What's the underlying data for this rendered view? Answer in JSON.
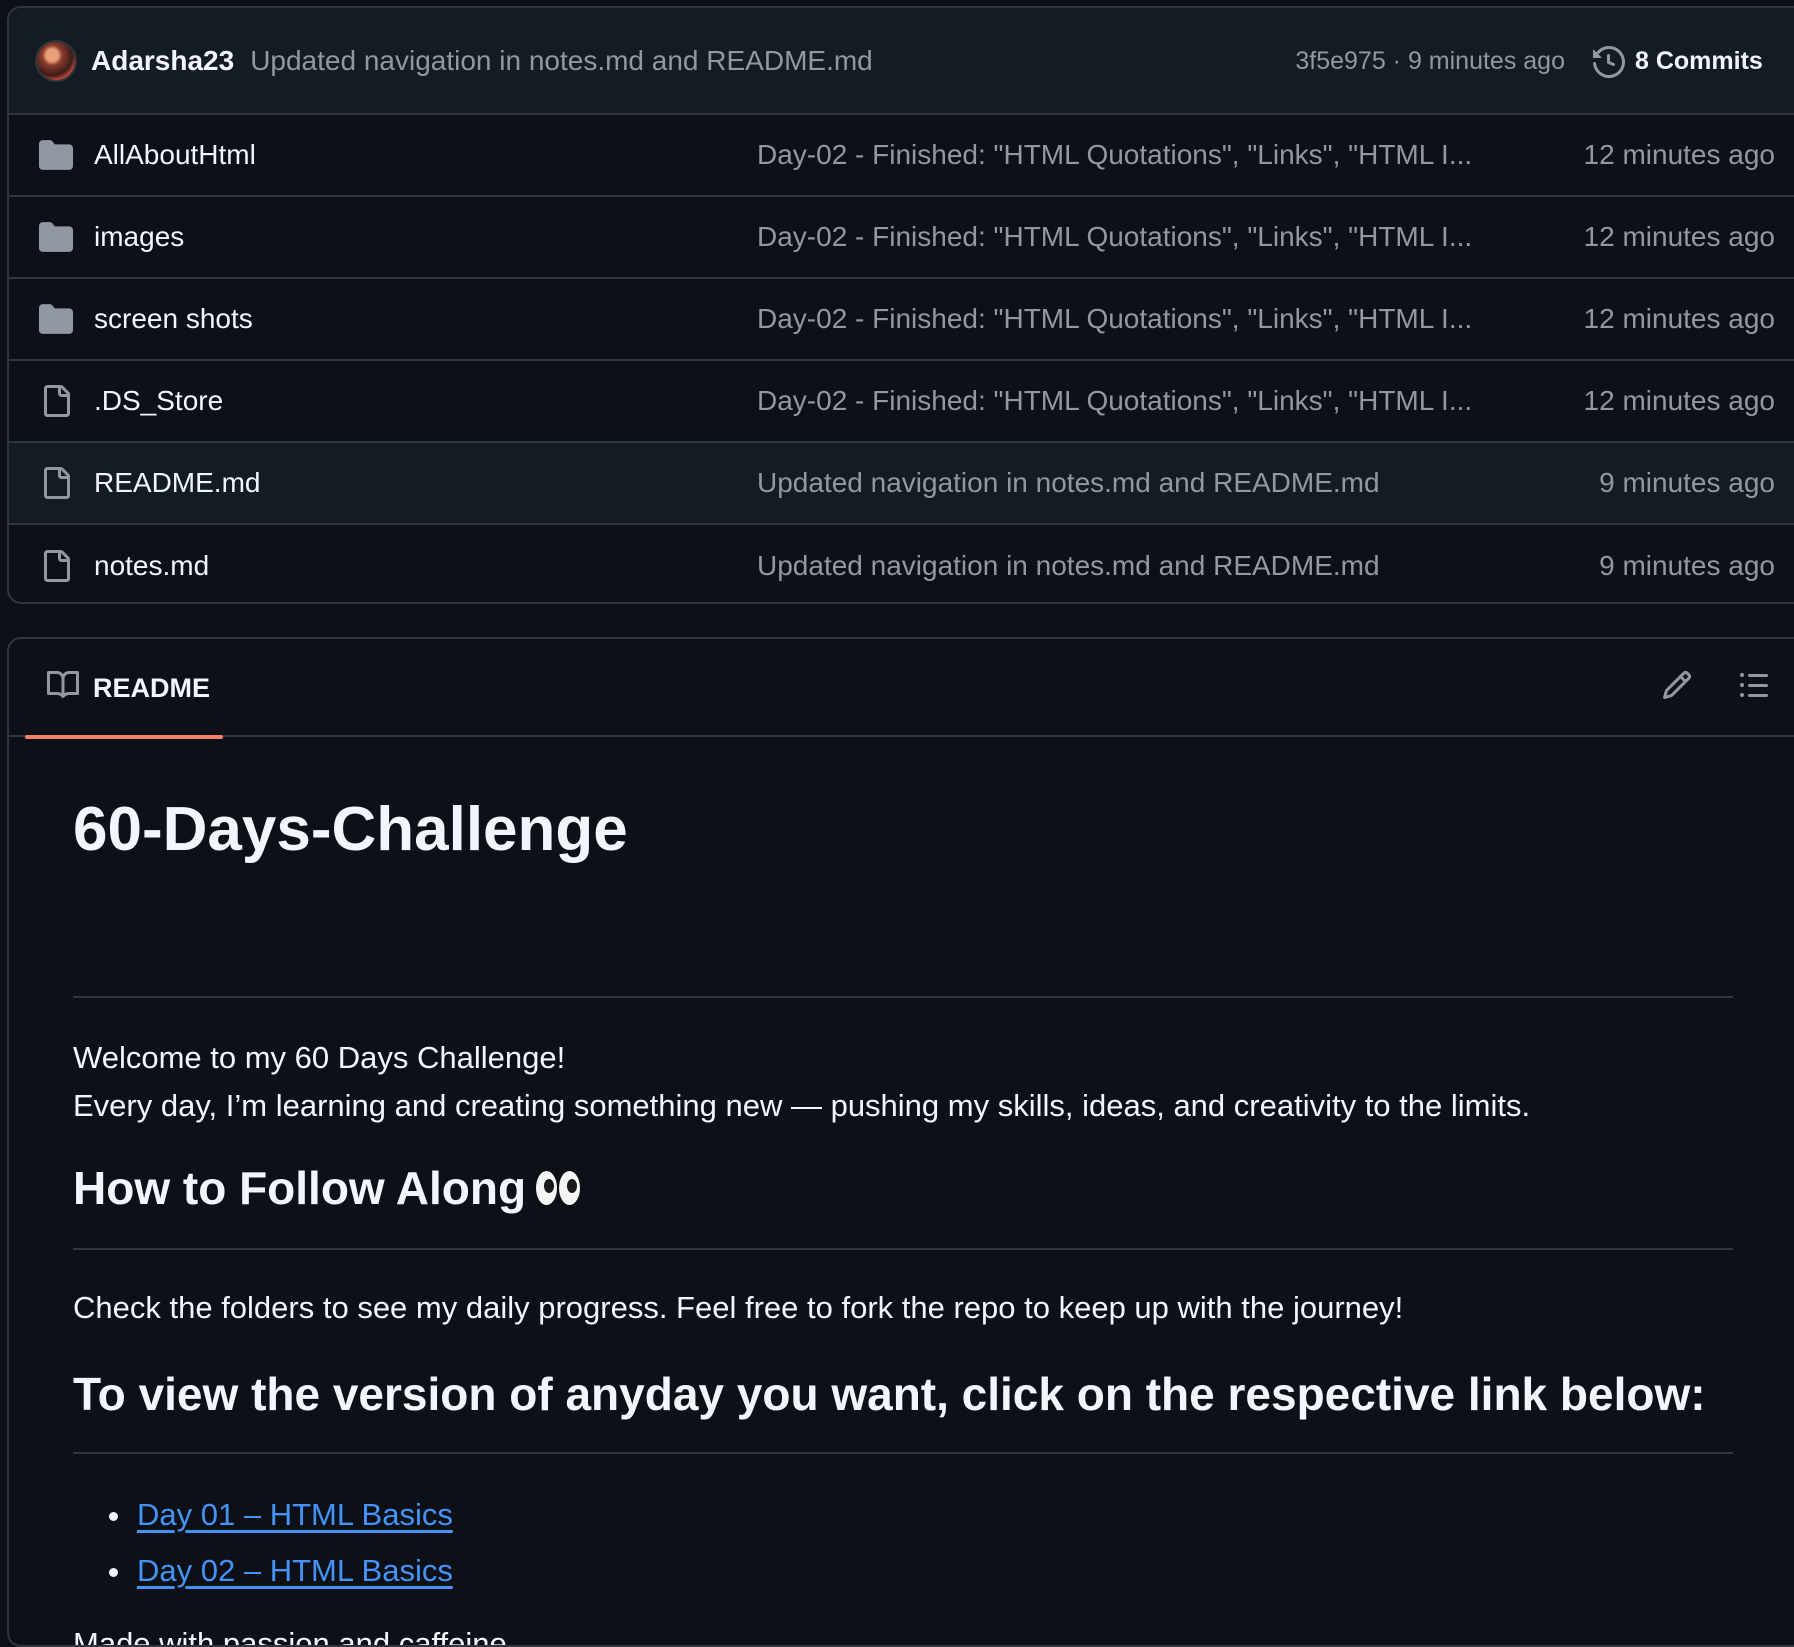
{
  "latest_commit": {
    "author": "Adarsha23",
    "message": "Updated navigation in notes.md and README.md",
    "hash_time": "3f5e975 · 9 minutes ago",
    "commits_label": "8 Commits"
  },
  "files": [
    {
      "type": "folder",
      "name": "AllAboutHtml",
      "commit": "Day-02 - Finished: \"HTML Quotations\", \"Links\", \"HTML I...",
      "time": "12 minutes ago",
      "icon": "folder-icon"
    },
    {
      "type": "folder",
      "name": "images",
      "commit": "Day-02 - Finished: \"HTML Quotations\", \"Links\", \"HTML I...",
      "time": "12 minutes ago",
      "icon": "folder-icon"
    },
    {
      "type": "folder",
      "name": "screen shots",
      "commit": "Day-02 - Finished: \"HTML Quotations\", \"Links\", \"HTML I...",
      "time": "12 minutes ago",
      "icon": "folder-icon"
    },
    {
      "type": "file",
      "name": ".DS_Store",
      "commit": "Day-02 - Finished: \"HTML Quotations\", \"Links\", \"HTML I...",
      "time": "12 minutes ago",
      "icon": "file-icon"
    },
    {
      "type": "file",
      "name": "README.md",
      "commit": "Updated navigation in notes.md and README.md",
      "time": "9 minutes ago",
      "icon": "file-icon"
    },
    {
      "type": "file",
      "name": "notes.md",
      "commit": "Updated navigation in notes.md and README.md",
      "time": "9 minutes ago",
      "icon": "file-icon"
    }
  ],
  "readme": {
    "tab_label": "README",
    "h1": "60-Days-Challenge",
    "intro_line1": "Welcome to my 60 Days Challenge!",
    "intro_line2": "Every day, I’m learning and creating something new — pushing my skills, ideas, and creativity to the limits.",
    "h2_follow": "How to Follow Along",
    "follow_text": "Check the folders to see my daily progress. Feel free to fork the repo to keep up with the journey!",
    "h2_view": "To view the version of anyday you want, click on the respective link below:",
    "links": [
      "Day 01 – HTML Basics",
      "Day 02 – HTML Basics"
    ],
    "footer": "Made with passion and caffeine"
  },
  "colors": {
    "background": "#0d1117",
    "header_bg": "#151b23",
    "border": "#30363d",
    "muted_text": "#9198a1",
    "link": "#4493f8",
    "tab_underline": "#f78166",
    "folder_icon": "#9198a1"
  }
}
